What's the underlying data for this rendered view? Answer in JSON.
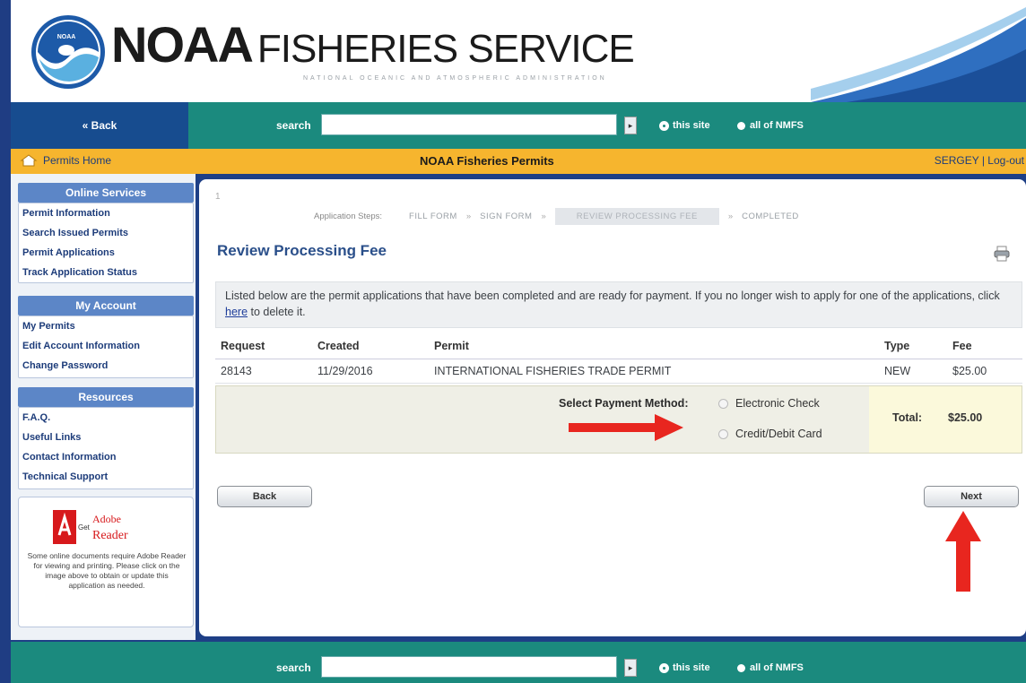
{
  "header": {
    "brand_main": "NOAA",
    "brand_sub": "FISHERIES SERVICE",
    "tagline": "NATIONAL OCEANIC AND ATMOSPHERIC ADMINISTRATION",
    "logo_text": "NOAA"
  },
  "nav": {
    "back_label": "« Back",
    "search_label": "search",
    "search_value": "",
    "go_label": "▸",
    "option_this_site": "this site",
    "option_all": "all of NMFS"
  },
  "ybar": {
    "home_label": "Permits Home",
    "title": "NOAA Fisheries Permits",
    "user": "SERGEY",
    "logout": "Log-out"
  },
  "sidebar": {
    "online_services": {
      "title": "Online Services",
      "items": [
        "Permit Information",
        "Search Issued Permits",
        "Permit Applications",
        "Track Application Status"
      ]
    },
    "my_account": {
      "title": "My Account",
      "items": [
        "My Permits",
        "Edit Account Information",
        "Change Password"
      ]
    },
    "resources": {
      "title": "Resources",
      "items": [
        "F.A.Q.",
        "Useful Links",
        "Contact Information",
        "Technical Support"
      ]
    },
    "adobe": {
      "get": "Get",
      "adobe": "Adobe",
      "reader": "Reader",
      "note": "Some online documents require Adobe Reader for viewing and printing. Please click on the image above to obtain or update this application as needed."
    }
  },
  "main": {
    "tick": "1",
    "steps": {
      "label": "Application Steps:",
      "items": [
        "FILL FORM",
        "SIGN FORM",
        "REVIEW PROCESSING FEE",
        "COMPLETED"
      ],
      "separator": "»",
      "active_index": 2
    },
    "title": "Review Processing Fee",
    "notice_before": "Listed below are the permit applications that have been completed and are ready for payment. If you no longer wish to apply for one of the applications, click ",
    "notice_link": "here",
    "notice_after": " to delete it.",
    "table": {
      "headers": [
        "Request",
        "Created",
        "Permit",
        "Type",
        "Fee"
      ],
      "rows": [
        [
          "28143",
          "11/29/2016",
          "INTERNATIONAL FISHERIES TRADE PERMIT",
          "NEW",
          "$25.00"
        ]
      ]
    },
    "payment": {
      "label": "Select Payment Method:",
      "options": [
        "Electronic Check",
        "Credit/Debit Card"
      ],
      "total_label": "Total:",
      "total_value": "$25.00"
    },
    "back_button": "Back",
    "next_button": "Next"
  },
  "footer": {
    "search_label": "search",
    "search_value": "",
    "go_label": "▸",
    "option_this_site": "this site",
    "option_all": "all of NMFS"
  },
  "colors": {
    "navy": "#1e3f86",
    "teal": "#1b8a7e",
    "yellow": "#f6b52e",
    "title_blue": "#2a4f8a",
    "annotation_red": "#e8261f"
  }
}
